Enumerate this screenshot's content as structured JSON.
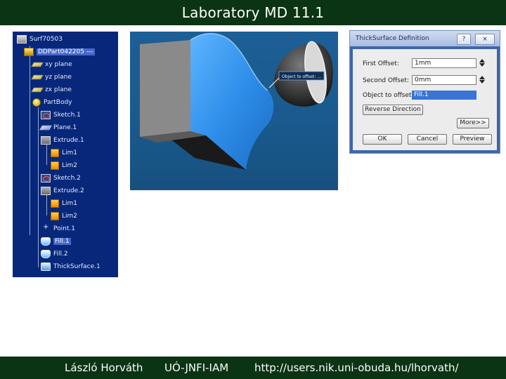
{
  "slide": {
    "title": "Laboratory MD 11.1",
    "footer": {
      "author": "László Horváth",
      "institute": "UÓ-JNFI-IAM",
      "url": "http://users.nik.uni-obuda.hu/lhorvath/"
    }
  },
  "tree": {
    "items": [
      {
        "label": "Surf70503",
        "icon": "assembly-icon"
      },
      {
        "label": "DDPart042205 ---",
        "icon": "part-icon",
        "selected": true
      },
      {
        "label": "xy plane",
        "icon": "plane-icon"
      },
      {
        "label": "yz plane",
        "icon": "plane-icon"
      },
      {
        "label": "zx plane",
        "icon": "plane-icon"
      },
      {
        "label": "PartBody",
        "icon": "partbody-icon"
      },
      {
        "label": "Sketch.1",
        "icon": "sketch-icon"
      },
      {
        "label": "Plane.1",
        "icon": "plane-icon"
      },
      {
        "label": "Extrude.1",
        "icon": "extrude-icon"
      },
      {
        "label": "Lim1",
        "icon": "limit-icon"
      },
      {
        "label": "Lim2",
        "icon": "limit-icon"
      },
      {
        "label": "Sketch.2",
        "icon": "sketch-icon"
      },
      {
        "label": "Extrude.2",
        "icon": "extrude-icon"
      },
      {
        "label": "Lim1",
        "icon": "limit-icon"
      },
      {
        "label": "Lim2",
        "icon": "limit-icon"
      },
      {
        "label": "Point.1",
        "icon": "point-icon"
      },
      {
        "label": "Fill.1",
        "icon": "fill-icon",
        "selected": true
      },
      {
        "label": "Fill.2",
        "icon": "fill-icon"
      },
      {
        "label": "ThickSurface.1",
        "icon": "thicksurface-icon"
      }
    ]
  },
  "viewport": {
    "tag": "Object to offset: ..."
  },
  "dialog": {
    "title": "ThickSurface Definition",
    "help": "?",
    "close": "×",
    "first_offset_label": "First Offset:",
    "first_offset_value": "1mm",
    "second_offset_label": "Second Offset:",
    "second_offset_value": "0mm",
    "object_label": "Object to offset:",
    "object_value": "Fill.1",
    "reverse_button": "Reverse Direction",
    "more_button": "More>>",
    "ok_button": "OK",
    "cancel_button": "Cancel",
    "preview_button": "Preview"
  },
  "colors": {
    "title_bar": "#0a3413",
    "tree_background": "#07277a",
    "viewport_background": "#1c5f96",
    "selection": "#3a74d6"
  }
}
